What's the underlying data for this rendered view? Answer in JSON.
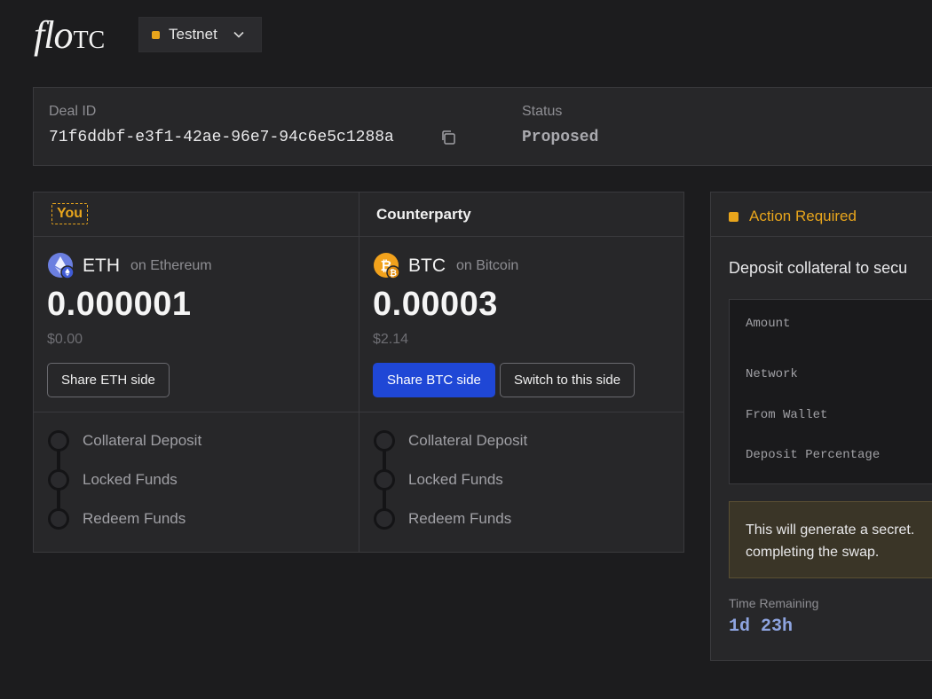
{
  "brand": {
    "logo_italic": "flo",
    "logo_caps": "TC"
  },
  "network": {
    "label": "Testnet",
    "color": "#e8a51c"
  },
  "deal": {
    "id_label": "Deal ID",
    "id_value": "71f6ddbf-e3f1-42ae-96e7-94c6e5c1288a",
    "status_label": "Status",
    "status_value": "Proposed"
  },
  "swap": {
    "you_label": "You",
    "counterparty_label": "Counterparty",
    "you_side": {
      "symbol": "ETH",
      "network": "on Ethereum",
      "amount": "0.000001",
      "usd": "$0.00",
      "share_button": "Share ETH side",
      "icon": "ethereum-icon"
    },
    "counterparty_side": {
      "symbol": "BTC",
      "network": "on Bitcoin",
      "amount": "0.00003",
      "usd": "$2.14",
      "share_button": "Share BTC side",
      "switch_button": "Switch to this side",
      "icon": "bitcoin-icon"
    },
    "steps": [
      "Collateral Deposit",
      "Locked Funds",
      "Redeem Funds"
    ]
  },
  "action": {
    "title": "Action Required",
    "text": "Deposit collateral to secu",
    "details": [
      "Amount",
      "Network",
      "From Wallet",
      "Deposit Percentage"
    ],
    "note_line1": "This will generate a secret.",
    "note_line2": "completing the swap.",
    "time_label": "Time Remaining",
    "time_value": "1d 23h"
  },
  "colors": {
    "accent": "#e8a51c",
    "primary": "#1f47d6",
    "background": "#1c1c1e"
  }
}
